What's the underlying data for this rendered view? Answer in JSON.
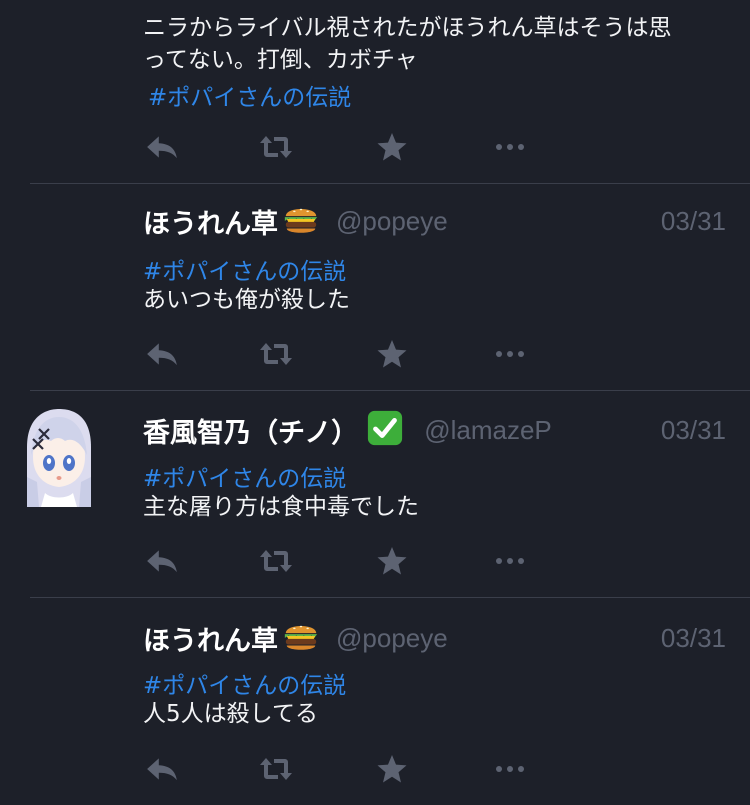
{
  "tweets": [
    {
      "lines": [
        "ニラからライバル視されたがほうれん草はそうは思",
        "ってない。打倒、カボチャ"
      ],
      "hashtag": "#ポパイさんの伝説"
    },
    {
      "name": "ほうれん草",
      "handle": "@popeye",
      "date": "03/31",
      "hashtag": "#ポパイさんの伝説",
      "text": "あいつも俺が殺した"
    },
    {
      "name": "香風智乃（チノ）",
      "handle": "@lamazeP",
      "date": "03/31",
      "hashtag": "#ポパイさんの伝説",
      "text": "主な屠り方は食中毒でした"
    },
    {
      "name": "ほうれん草",
      "handle": "@popeye",
      "date": "03/31",
      "hashtag": "#ポパイさんの伝説",
      "text": "人5人は殺してる"
    }
  ],
  "icons": {
    "reply": "reply-icon",
    "retweet": "retweet-icon",
    "favorite": "star-icon",
    "more": "more-icon",
    "name_emoji_popeye": "hamburger-icon",
    "name_emoji_chino": "check-mark-icon"
  },
  "colors": {
    "background": "#1d2029",
    "hashtag": "#2f86e8",
    "muted": "#5d6372",
    "divider": "#3a3e4a",
    "check": "#3dae3a"
  }
}
